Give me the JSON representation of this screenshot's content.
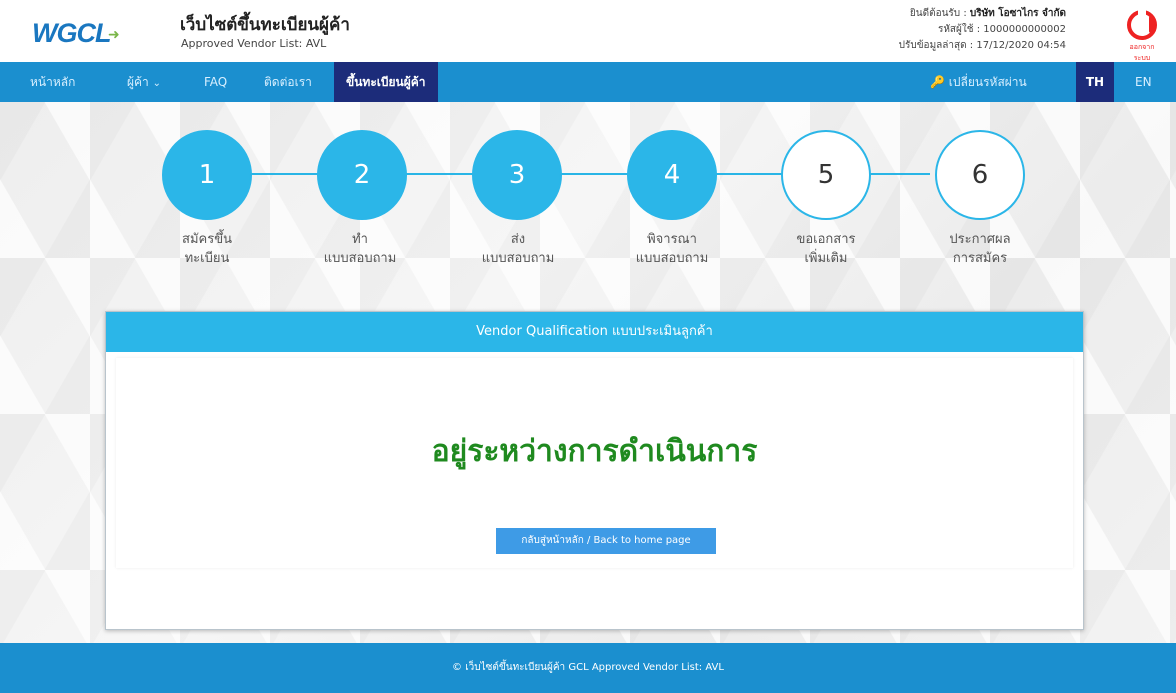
{
  "header": {
    "logo_text": "WGCL",
    "site_title": "เว็บไซต์ขึ้นทะเบียนผู้ค้า",
    "site_subtitle": "Approved Vendor List: AVL",
    "welcome_label": "ยินดีต้อนรับ : ",
    "welcome_company": "บริษัท โอซาไกร จำกัด",
    "user_code": "รหัสผู้ใช้ : 1000000000002",
    "last_update": "ปรับข้อมูลล่าสุด : 17/12/2020 04:54",
    "logout_label": "ออกจากระบบ"
  },
  "nav": {
    "home": "หน้าหลัก",
    "vendor": "ผู้ค้า",
    "faq": "FAQ",
    "contact": "ติดต่อเรา",
    "register": "ขึ้นทะเบียนผู้ค้า",
    "change_password": "เปลี่ยนรหัสผ่าน",
    "lang_th": "TH",
    "lang_en": "EN"
  },
  "steps": [
    {
      "number": "1",
      "label": "สมัครขึ้น\nทะเบียน",
      "status": "done"
    },
    {
      "number": "2",
      "label": "ทำ\nแบบสอบถาม",
      "status": "done"
    },
    {
      "number": "3",
      "label": "ส่ง\nแบบสอบถาม",
      "status": "done"
    },
    {
      "number": "4",
      "label": "พิจารณา\nแบบสอบถาม",
      "status": "done"
    },
    {
      "number": "5",
      "label": "ขอเอกสาร\nเพิ่มเติม",
      "status": "todo"
    },
    {
      "number": "6",
      "label": "ประกาศผล\nการสมัคร",
      "status": "todo"
    }
  ],
  "panel": {
    "title": "Vendor Qualification แบบประเมินลูกค้า",
    "status": "อยู่ระหว่างการดำเนินการ",
    "back_button": "กลับสู่หน้าหลัก / Back to home page"
  },
  "footer": {
    "text": "© เว็บไซต์ขึ้นทะเบียนผู้ค้า GCL Approved Vendor List: AVL"
  },
  "colors": {
    "primary": "#1b8fcf",
    "step_active": "#2bb6e8",
    "nav_active": "#1c2c7a",
    "status_green": "#1f8a1f",
    "button": "#3e9be6",
    "logout_red": "#e22222"
  }
}
